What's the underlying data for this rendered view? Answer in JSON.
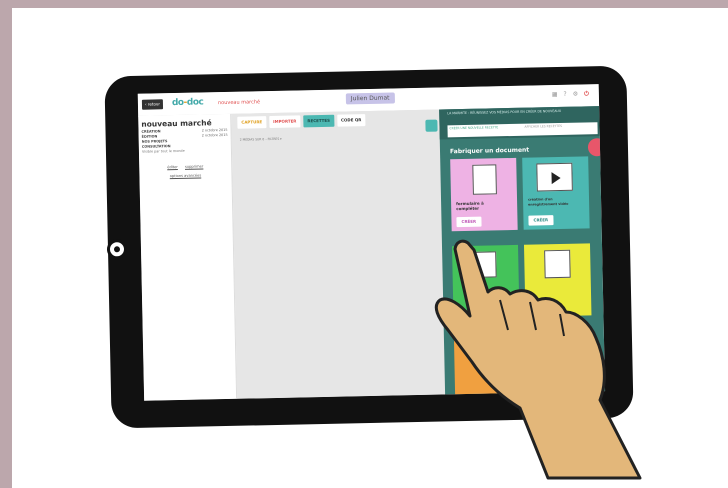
{
  "app": {
    "back_label": "‹ retour",
    "logo_part1": "do",
    "logo_part2": "doc",
    "project_title": "nouveau marché",
    "user_name": "Julien Dumat",
    "header_icons": [
      "grid-icon",
      "help-icon",
      "gear-icon",
      "power-icon"
    ]
  },
  "left_panel": {
    "title": "nouveau marché",
    "rows": [
      {
        "label": "CRÉATION",
        "value": "2 octobre 2015"
      },
      {
        "label": "ÉDITION",
        "value": "2 octobre 2015"
      },
      {
        "label": "NOS PROJETS",
        "value": ""
      },
      {
        "label": "CONSULTATION",
        "value": ""
      }
    ],
    "visibility": "Visible par tout le monde",
    "actions": [
      "éditer",
      "supprimer",
      "options avancées"
    ]
  },
  "toolbar": {
    "capture": "CAPTURE",
    "import": "IMPORTER",
    "recipes": "RECETTES",
    "qr": "CODE QR"
  },
  "center": {
    "filter": "2 MÉDIAS SUR 0 – FILTRES ▾"
  },
  "right_panel": {
    "header": "LA MARMITE : RÉUNISSEZ VOS MÉDIAS POUR EN CRÉER DE NOUVEAUX",
    "tab_create": "CRÉER UNE NOUVELLE RECETTE",
    "tab_show": "AFFICHER LES RECETTES",
    "section_title": "Fabriquer un document",
    "cards": [
      {
        "label": "formulaire à compléter",
        "button": "CRÉER",
        "color": "#eeb2e4"
      },
      {
        "label": "création d'un enregistrement vidéo",
        "button": "CRÉER",
        "color": "#4cb8b2"
      },
      {
        "label": "",
        "button": "",
        "color": "#44c35a"
      },
      {
        "label": "",
        "button": "",
        "color": "#eaea3a"
      },
      {
        "label": "",
        "button": "",
        "color": "#f0a040"
      }
    ]
  }
}
